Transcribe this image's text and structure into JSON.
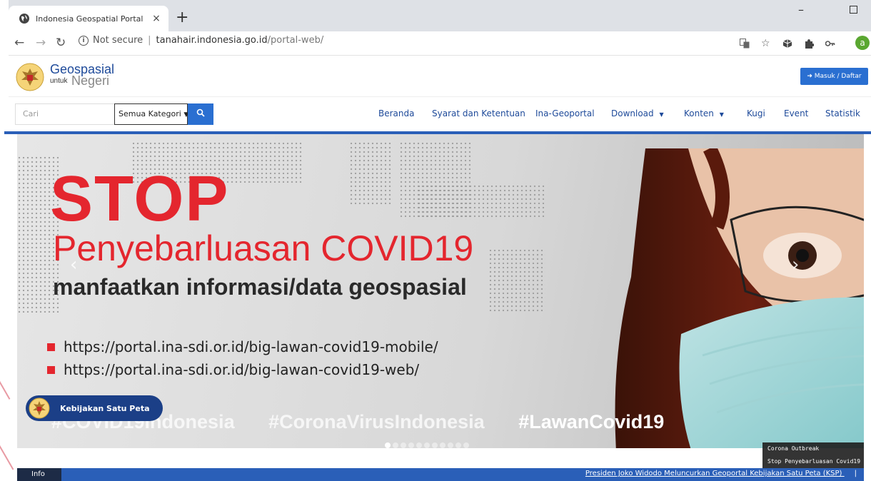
{
  "browser": {
    "tab_title": "Indonesia Geospatial Portal",
    "tab_close": "×",
    "new_tab": "+",
    "minimize": "–",
    "security_label": "Not secure",
    "url_domain": "tanahair.indonesia.go.id",
    "url_path": "/portal-web/",
    "profile_initial": "a"
  },
  "header": {
    "brand_title": "Geospasial",
    "brand_untuk": "untuk",
    "brand_negeri": "Negeri",
    "login_label": "Masuk / Daftar"
  },
  "search": {
    "placeholder": "Cari",
    "category_selected": "Semua Kategori"
  },
  "nav": {
    "items": [
      {
        "label": "Beranda"
      },
      {
        "label": "Syarat dan Ketentuan"
      },
      {
        "label": "Ina-Geoportal"
      },
      {
        "label": "Download"
      },
      {
        "label": "Konten"
      },
      {
        "label": "Kugi"
      },
      {
        "label": "Event"
      },
      {
        "label": "Statistik"
      }
    ]
  },
  "hero": {
    "stop": "STOP",
    "subtitle": "Penyebarluasan COVID19",
    "line3": "manfaatkan informasi/data geospasial",
    "links": [
      "https://portal.ina-sdi.or.id/big-lawan-covid19-mobile/",
      "https://portal.ina-sdi.or.id/big-lawan-covid19-web/"
    ],
    "tag1": "#COVID19Indonesia",
    "tag2": "#CoronaVirusIndonesia",
    "tag3": "#LawanCovid19",
    "slide_count": 11,
    "active_slide": 0,
    "prev_arrow": "‹",
    "next_arrow": "›"
  },
  "ksp": {
    "label": "Kebijakan Satu Peta"
  },
  "news": {
    "items": [
      "Corona Outbreak",
      "Stop Penyebarluasan Covid19"
    ]
  },
  "infobar": {
    "tag": "Info",
    "ticker": "Presiden Joko Widodo Meluncurkan Geoportal Kebijakan Satu Peta (KSP)",
    "pipe": "|"
  },
  "colors": {
    "brand_blue": "#1e4a9a",
    "button_blue": "#2a6fd1",
    "alert_red": "#e4262e",
    "info_bar": "#2a5fb8"
  }
}
